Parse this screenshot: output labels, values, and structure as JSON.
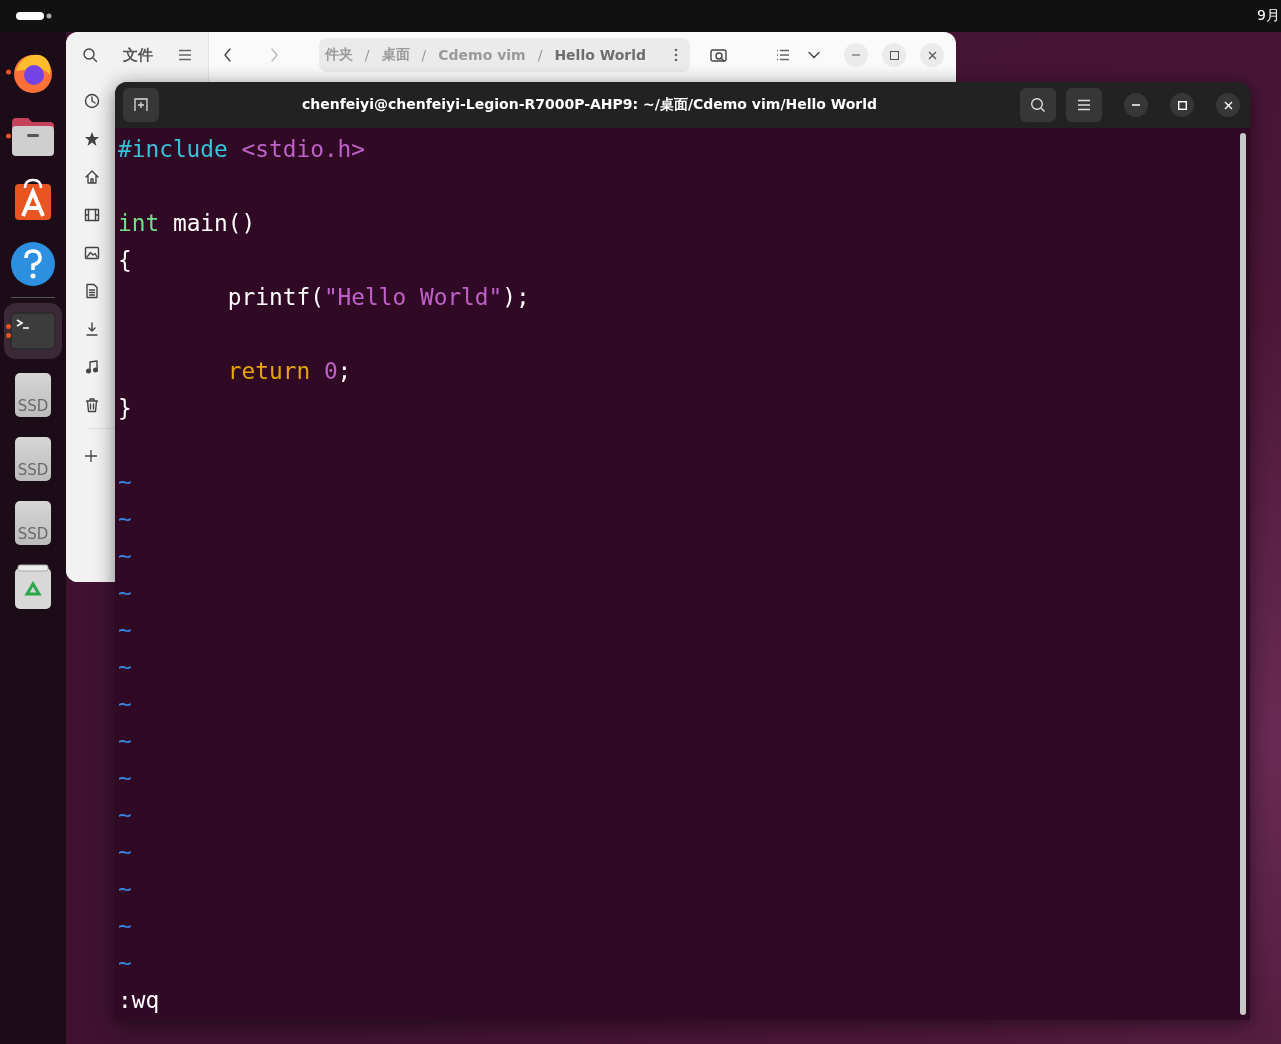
{
  "top_bar": {
    "clock": "9月"
  },
  "dock": {
    "items": [
      {
        "kind": "browser",
        "running": true,
        "multi_window": false,
        "selected": false
      },
      {
        "kind": "files",
        "running": true,
        "multi_window": false,
        "selected": false
      },
      {
        "kind": "store",
        "running": false,
        "multi_window": false,
        "selected": false
      },
      {
        "kind": "help",
        "running": false,
        "multi_window": false,
        "selected": false
      },
      {
        "kind": "terminal",
        "running": true,
        "multi_window": true,
        "selected": true
      },
      {
        "kind": "drive",
        "label": "SSD",
        "running": false,
        "multi_window": false,
        "selected": false
      },
      {
        "kind": "drive",
        "label": "SSD",
        "running": false,
        "multi_window": false,
        "selected": false
      },
      {
        "kind": "drive",
        "label": "SSD",
        "running": false,
        "multi_window": false,
        "selected": false
      },
      {
        "kind": "trash",
        "running": false,
        "multi_window": false,
        "selected": false
      }
    ]
  },
  "file_manager": {
    "sidebar_title": "文件",
    "sidebar_items": [
      {
        "kind": "recent"
      },
      {
        "kind": "starred"
      },
      {
        "kind": "home"
      },
      {
        "kind": "videos"
      },
      {
        "kind": "pictures"
      },
      {
        "kind": "documents"
      },
      {
        "kind": "downloads"
      },
      {
        "kind": "music"
      },
      {
        "kind": "trash"
      }
    ],
    "breadcrumb": [
      {
        "label": "件夹",
        "current": false
      },
      {
        "separator": "/",
        "label": "桌面",
        "current": false
      },
      {
        "separator": "/",
        "label": "Cdemo vim",
        "current": false
      },
      {
        "separator": "/",
        "label": "Hello World",
        "current": true
      }
    ]
  },
  "terminal": {
    "title": "chenfeiyi@chenfeiyi-Legion-R7000P-AHP9: ~/桌面/Cdemo vim/Hello World",
    "lines": [
      {
        "kind": "code",
        "indent": false,
        "tokens": [
          {
            "kind": "preproc",
            "text": "#include"
          },
          {
            "kind": "string",
            "text": " <stdio.h>"
          }
        ]
      },
      {
        "kind": "blank"
      },
      {
        "kind": "code",
        "indent": false,
        "tokens": [
          {
            "kind": "type",
            "text": "int"
          },
          {
            "kind": "plain",
            "text": " main()"
          }
        ]
      },
      {
        "kind": "code",
        "indent": false,
        "tokens": [
          {
            "kind": "plain",
            "text": "{"
          }
        ]
      },
      {
        "kind": "code",
        "indent": true,
        "tokens": [
          {
            "kind": "plain",
            "text": "printf("
          },
          {
            "kind": "string",
            "text": "\"Hello World\""
          },
          {
            "kind": "plain",
            "text": ");"
          }
        ]
      },
      {
        "kind": "blank"
      },
      {
        "kind": "code",
        "indent": true,
        "tokens": [
          {
            "kind": "keyword",
            "text": "return"
          },
          {
            "kind": "number",
            "text": " 0"
          },
          {
            "kind": "plain",
            "text": ";"
          }
        ]
      },
      {
        "kind": "code",
        "indent": false,
        "tokens": [
          {
            "kind": "plain",
            "text": "}"
          }
        ]
      },
      {
        "kind": "blank"
      }
    ],
    "empty_lines": [
      "~",
      "~",
      "~",
      "~",
      "~",
      "~",
      "~",
      "~",
      "~",
      "~",
      "~",
      "~",
      "~",
      "~"
    ],
    "command": ":wq"
  }
}
